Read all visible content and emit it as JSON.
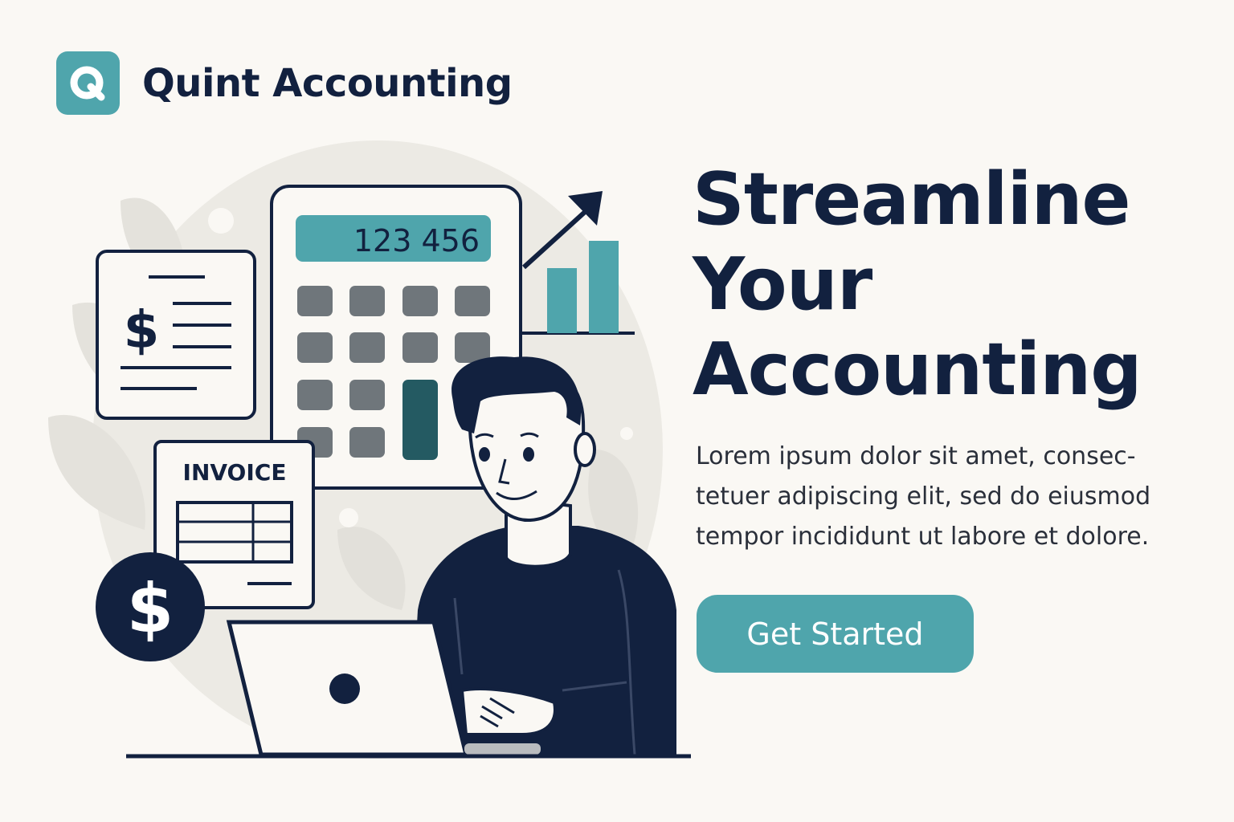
{
  "brand": {
    "logo_letter": "Q",
    "name": "Quint Accounting"
  },
  "illustration": {
    "calculator_display": "123 456",
    "invoice_label": "INVOICE",
    "receipt_symbol": "$",
    "coin_symbol": "$"
  },
  "hero": {
    "title_lines": [
      "Streamline",
      "Your",
      "Accounting"
    ],
    "body_lines": [
      "Lorem ipsum dolor sit amet, consec-",
      "tetuer adipiscing elit, sed do eiusmod",
      "tempor incididunt ut labore et dolore."
    ]
  },
  "cta": {
    "label": "Get Started"
  },
  "colors": {
    "accent": "#4fa5ac",
    "navy": "#12213f",
    "background": "#faf8f4",
    "key_gray": "#6f767b",
    "key_dark_teal": "#245a62"
  }
}
